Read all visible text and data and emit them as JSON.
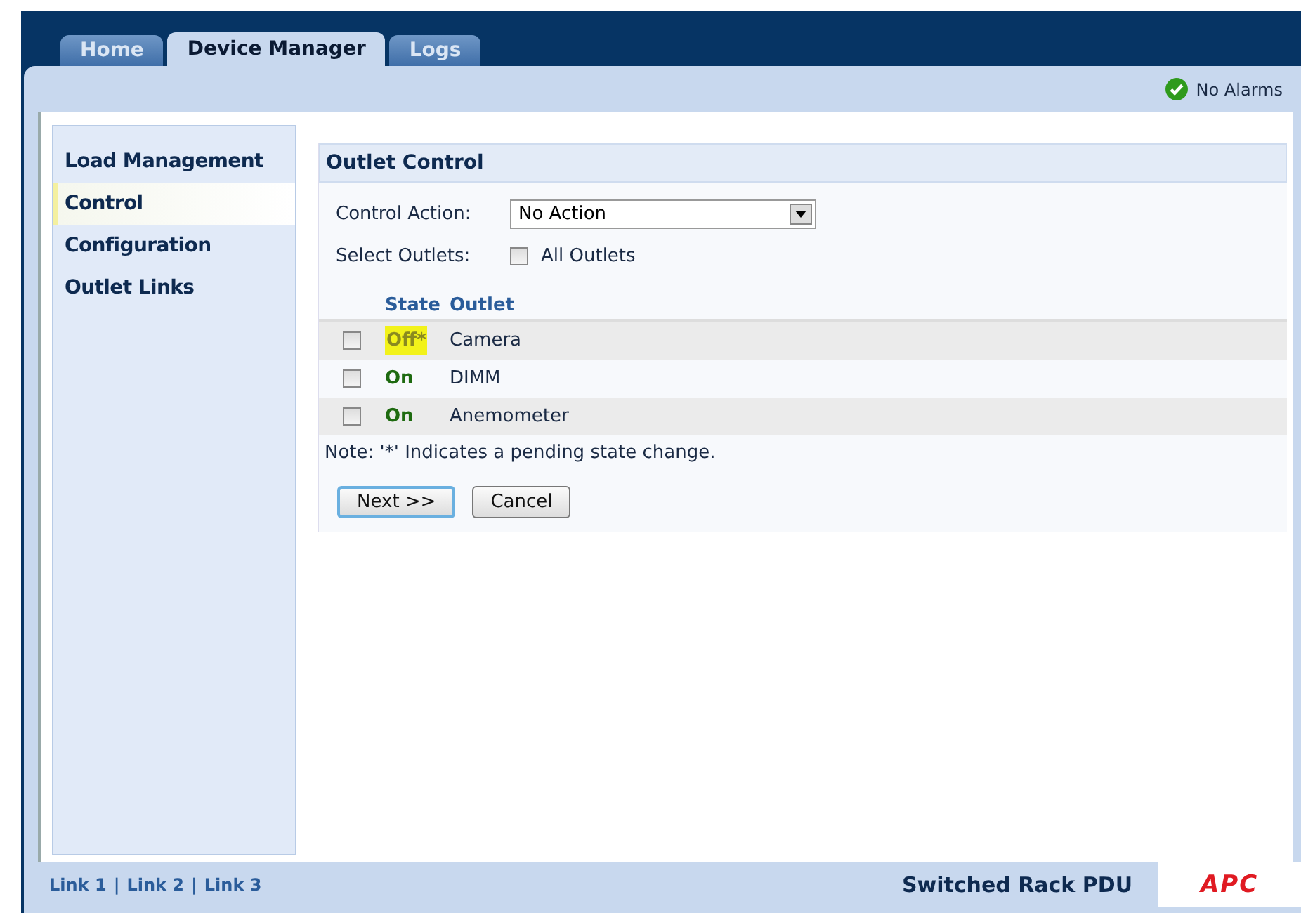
{
  "tabs": [
    {
      "label": "Home",
      "selected": false
    },
    {
      "label": "Device Manager",
      "selected": true
    },
    {
      "label": "Logs",
      "selected": false
    }
  ],
  "alarm_status": "No Alarms",
  "sidebar": {
    "items": [
      {
        "label": "Load Management",
        "selected": false
      },
      {
        "label": "Control",
        "selected": true
      },
      {
        "label": "Configuration",
        "selected": false
      },
      {
        "label": "Outlet Links",
        "selected": false
      }
    ]
  },
  "panel": {
    "title": "Outlet Control",
    "control_action": {
      "label": "Control Action:",
      "value": "No Action"
    },
    "select_outlets": {
      "label": "Select Outlets:",
      "option": "All Outlets",
      "checked": false
    },
    "columns": [
      "State",
      "Outlet"
    ],
    "rows": [
      {
        "checked": false,
        "state": "Off*",
        "on": false,
        "pending": true,
        "outlet": "Camera"
      },
      {
        "checked": false,
        "state": "On",
        "on": true,
        "pending": false,
        "outlet": "DIMM"
      },
      {
        "checked": false,
        "state": "On",
        "on": true,
        "pending": false,
        "outlet": "Anemometer"
      }
    ],
    "note": "Note: '*' Indicates a pending state change.",
    "buttons": [
      "Next >>",
      "Cancel"
    ]
  },
  "footer": {
    "links": [
      "Link 1",
      "Link 2",
      "Link 3"
    ],
    "separator": "|",
    "product": "Switched Rack PDU",
    "logo": "APC"
  }
}
